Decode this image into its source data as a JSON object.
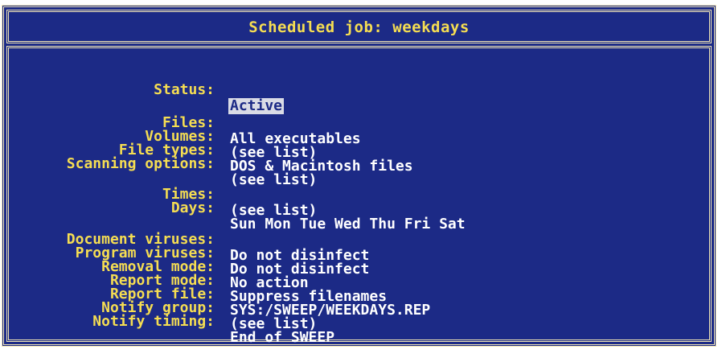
{
  "window": {
    "title": "Scheduled job: weekdays"
  },
  "fields": [
    {
      "label": "Status:",
      "value": "Active",
      "highlight": true
    },
    {
      "label": "Files:",
      "value": "All executables"
    },
    {
      "label": "Volumes:",
      "value": "(see list)"
    },
    {
      "label": "File types:",
      "value": "DOS & Macintosh files"
    },
    {
      "label": "Scanning options:",
      "value": "(see list)"
    },
    {
      "label": "Times:",
      "value": "(see list)"
    },
    {
      "label": "Days:",
      "value": "Sun Mon Tue Wed Thu Fri Sat"
    },
    {
      "label": "Document viruses:",
      "value": "Do not disinfect"
    },
    {
      "label": "Program viruses:",
      "value": "Do not disinfect"
    },
    {
      "label": "Removal mode:",
      "value": "No action"
    },
    {
      "label": "Report mode:",
      "value": "Suppress filenames"
    },
    {
      "label": "Report file:",
      "value": "SYS:/SWEEP/WEEKDAYS.REP"
    },
    {
      "label": "Notify group:",
      "value": "(see list)"
    },
    {
      "label": "Notify timing:",
      "value": "End of SWEEP"
    }
  ],
  "colors": {
    "background": "#1c2a86",
    "label": "#f5dd52",
    "value": "#ffffff",
    "border": "#f2e6b6",
    "highlight": "#d9dbe6"
  }
}
